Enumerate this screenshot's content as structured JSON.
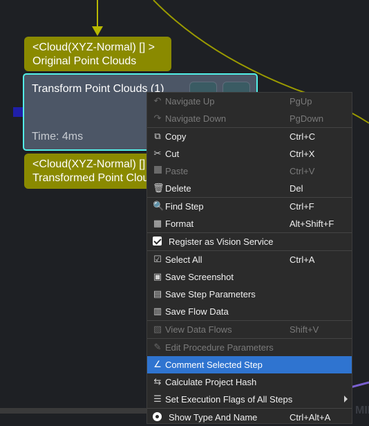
{
  "graph": {
    "input_port_block": {
      "line1": "<Cloud(XYZ-Normal) [] >",
      "line2": "Original Point Clouds"
    },
    "step_node": {
      "title": "Transform Point Clouds (1)",
      "time": "Time: 4ms",
      "accent_color": "#52f0e8"
    },
    "output_port_block": {
      "line1": "<Cloud(XYZ-Normal) [] >",
      "line2": "Transformed Point Clouds"
    },
    "port_color": "#8a8a00"
  },
  "context_menu": {
    "highlight_color": "#2f74d0",
    "items": [
      {
        "icon": "undo-icon",
        "label": "Navigate Up",
        "shortcut": "PgUp",
        "enabled": false
      },
      {
        "icon": "redo-icon",
        "label": "Navigate Down",
        "shortcut": "PgDown",
        "enabled": false
      },
      {
        "icon": "copy-icon",
        "label": "Copy",
        "shortcut": "Ctrl+C",
        "enabled": true
      },
      {
        "icon": "cut-icon",
        "label": "Cut",
        "shortcut": "Ctrl+X",
        "enabled": true
      },
      {
        "icon": "paste-icon",
        "label": "Paste",
        "shortcut": "Ctrl+V",
        "enabled": false
      },
      {
        "icon": "trash-icon",
        "label": "Delete",
        "shortcut": "Del",
        "enabled": true
      },
      {
        "icon": "search-icon",
        "label": "Find Step",
        "shortcut": "Ctrl+F",
        "enabled": true
      },
      {
        "icon": "format-icon",
        "label": "Format",
        "shortcut": "Alt+Shift+F",
        "enabled": true
      },
      {
        "icon": "checkbox-checked-icon",
        "label": "Register as Vision Service",
        "shortcut": "",
        "enabled": true,
        "checked": true
      },
      {
        "icon": "select-all-icon",
        "label": "Select All",
        "shortcut": "Ctrl+A",
        "enabled": true
      },
      {
        "icon": "screenshot-icon",
        "label": "Save Screenshot",
        "shortcut": "",
        "enabled": true
      },
      {
        "icon": "save-parameters-icon",
        "label": "Save Step Parameters",
        "shortcut": "",
        "enabled": true
      },
      {
        "icon": "save-flow-icon",
        "label": "Save Flow Data",
        "shortcut": "",
        "enabled": true
      },
      {
        "icon": "data-flow-icon",
        "label": "View Data Flows",
        "shortcut": "Shift+V",
        "enabled": false
      },
      {
        "icon": "edit-procedure-icon",
        "label": "Edit Procedure Parameters",
        "shortcut": "",
        "enabled": false
      },
      {
        "icon": "comment-icon",
        "label": "Comment Selected Step",
        "shortcut": "",
        "enabled": true,
        "highlighted": true
      },
      {
        "icon": "hash-icon",
        "label": "Calculate Project Hash",
        "shortcut": "",
        "enabled": true
      },
      {
        "icon": "flags-icon",
        "label": "Set Execution Flags of All Steps",
        "shortcut": "",
        "enabled": true,
        "submenu": true
      },
      {
        "icon": "radio-selected-icon",
        "label": "Show Type And Name",
        "shortcut": "Ctrl+Alt+A",
        "enabled": true,
        "radio": true
      }
    ]
  }
}
